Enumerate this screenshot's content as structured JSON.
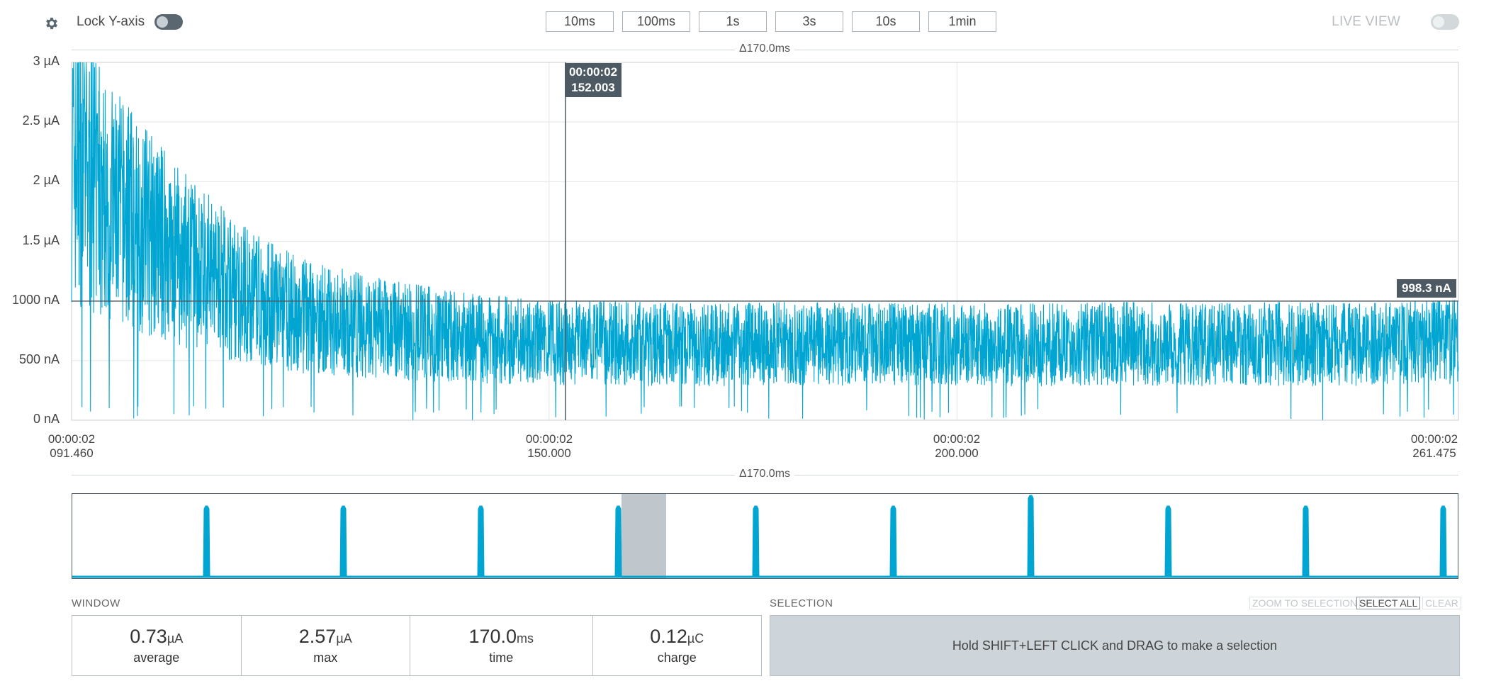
{
  "toolbar": {
    "settings_icon": "gear-icon",
    "lock_y_label": "Lock Y-axis",
    "lock_y_on": true,
    "window_buttons": [
      "10ms",
      "100ms",
      "1s",
      "3s",
      "10s",
      "1min"
    ],
    "live_view_label": "LIVE VIEW",
    "live_view_on": false
  },
  "main_chart": {
    "delta_label": "Δ170.0ms",
    "y_ticks": [
      "3 µA",
      "2.5 µA",
      "2 µA",
      "1.5 µA",
      "1000 nA",
      "500 nA",
      "0 nA"
    ],
    "x_ticks": [
      {
        "time": "00:00:02",
        "ms": "091.460"
      },
      {
        "time": "00:00:02",
        "ms": "150.000"
      },
      {
        "time": "00:00:02",
        "ms": "200.000"
      },
      {
        "time": "00:00:02",
        "ms": "261.475"
      }
    ],
    "cursor_time": "00:00:02",
    "cursor_ms": "152.003",
    "hline_value_label": "998.3 nA",
    "series_color": "#00a5d2"
  },
  "chart_data": {
    "type": "line",
    "x_unit": "ms",
    "y_unit": "nA",
    "x_range": [
      91.46,
      261.475
    ],
    "ylim": [
      0,
      3000
    ],
    "x_ticks": [
      91.46,
      150,
      200,
      261.475
    ],
    "y_ticks": [
      0,
      500,
      1000,
      1500,
      2000,
      2500,
      3000
    ],
    "grid": true,
    "cursor_x": 152.003,
    "hline_y": 998.3,
    "series": [
      {
        "x": [
          91.46,
          95,
          100,
          105,
          110,
          115,
          120,
          130,
          140,
          150,
          160,
          170,
          180,
          190,
          200,
          210,
          220,
          230,
          240,
          250,
          261.475
        ],
        "y": [
          2200,
          1900,
          1600,
          1350,
          1150,
          980,
          870,
          760,
          690,
          650,
          640,
          630,
          640,
          630,
          640,
          630,
          640,
          630,
          640,
          630,
          650
        ]
      }
    ]
  },
  "overview_chart": {
    "delta_label": "Δ170.0ms",
    "series_color": "#00a5d2",
    "selection_window_color": "#bfc7cc"
  },
  "window_panel": {
    "title": "WINDOW",
    "stats": [
      {
        "value": "0.73",
        "unit": "µA",
        "label": "average"
      },
      {
        "value": "2.57",
        "unit": "µA",
        "label": "max"
      },
      {
        "value": "170.0",
        "unit": "ms",
        "label": "time"
      },
      {
        "value": "0.12",
        "unit": "µC",
        "label": "charge"
      }
    ]
  },
  "selection_panel": {
    "title": "SELECTION",
    "zoom_label": "ZOOM TO SELECTION",
    "select_all_label": "SELECT ALL",
    "clear_label": "CLEAR",
    "hint": "Hold SHIFT+LEFT CLICK and DRAG to make a selection"
  }
}
